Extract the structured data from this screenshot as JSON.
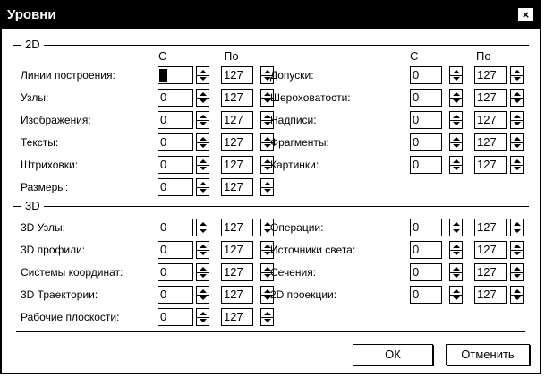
{
  "window": {
    "title": "Уровни",
    "close_glyph": "×"
  },
  "group_2d": {
    "label": "2D",
    "col_from": "С",
    "col_to": "По",
    "left": [
      {
        "label": "Линии построения:",
        "from": "0",
        "to": "127"
      },
      {
        "label": "Узлы:",
        "from": "0",
        "to": "127"
      },
      {
        "label": "Изображения:",
        "from": "0",
        "to": "127"
      },
      {
        "label": "Тексты:",
        "from": "0",
        "to": "127"
      },
      {
        "label": "Штриховки:",
        "from": "0",
        "to": "127"
      },
      {
        "label": "Размеры:",
        "from": "0",
        "to": "127"
      }
    ],
    "right": [
      {
        "label": "Допуски:",
        "from": "0",
        "to": "127"
      },
      {
        "label": "Шероховатости:",
        "from": "0",
        "to": "127"
      },
      {
        "label": "Надписи:",
        "from": "0",
        "to": "127"
      },
      {
        "label": "Фрагменты:",
        "from": "0",
        "to": "127"
      },
      {
        "label": "Картинки:",
        "from": "0",
        "to": "127"
      }
    ]
  },
  "group_3d": {
    "label": "3D",
    "left": [
      {
        "label": "3D Узлы:",
        "from": "0",
        "to": "127"
      },
      {
        "label": "3D профили:",
        "from": "0",
        "to": "127"
      },
      {
        "label": "Системы координат:",
        "from": "0",
        "to": "127"
      },
      {
        "label": "3D Траектории:",
        "from": "0",
        "to": "127"
      },
      {
        "label": "Рабочие плоскости:",
        "from": "0",
        "to": "127"
      }
    ],
    "right": [
      {
        "label": "Операции:",
        "from": "0",
        "to": "127"
      },
      {
        "label": "Источники света:",
        "from": "0",
        "to": "127"
      },
      {
        "label": "Сечения:",
        "from": "0",
        "to": "127"
      },
      {
        "label": "2D проекции:",
        "from": "0",
        "to": "127"
      }
    ]
  },
  "buttons": {
    "ok": "ОК",
    "cancel": "Отменить"
  }
}
